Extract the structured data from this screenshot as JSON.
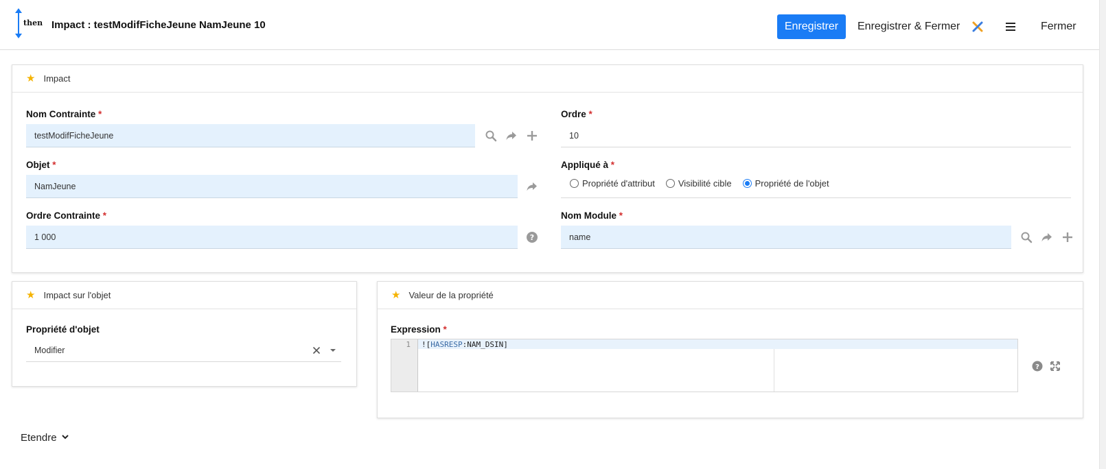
{
  "header": {
    "logo_text": "then",
    "title": "Impact : testModifFicheJeune NamJeune 10",
    "save_label": "Enregistrer",
    "save_close_label": "Enregistrer & Fermer",
    "close_label": "Fermer"
  },
  "panel_impact": {
    "title": "Impact",
    "nom_contrainte": {
      "label": "Nom Contrainte",
      "required": "*",
      "value": "testModifFicheJeune"
    },
    "objet": {
      "label": "Objet",
      "required": "*",
      "value": "NamJeune"
    },
    "ordre_contrainte": {
      "label": "Ordre Contrainte",
      "required": "*",
      "value": "1 000"
    },
    "ordre": {
      "label": "Ordre",
      "required": "*",
      "value": "10"
    },
    "applique_a": {
      "label": "Appliqué à",
      "required": "*",
      "options": [
        "Propriété d'attribut",
        "Visibilité cible",
        "Propriété de l'objet"
      ],
      "selected_index": 2
    },
    "nom_module": {
      "label": "Nom Module",
      "required": "*",
      "value": "name"
    }
  },
  "panel_impact_objet": {
    "title": "Impact sur l'objet",
    "propriete": {
      "label": "Propriété d'objet",
      "value": "Modifier"
    }
  },
  "panel_valeur": {
    "title": "Valeur de la propriété",
    "expression": {
      "label": "Expression",
      "required": "*",
      "line_number": "1",
      "code_prefix": "![",
      "code_keyword": "HASRESP",
      "code_rest": ":NAM_DSIN]"
    }
  },
  "footer": {
    "extend_label": "Etendre"
  },
  "colors": {
    "primary": "#1a7cf5",
    "field_bg": "#e4f1fd",
    "star": "#f5b301",
    "required": "#d32f2f"
  }
}
